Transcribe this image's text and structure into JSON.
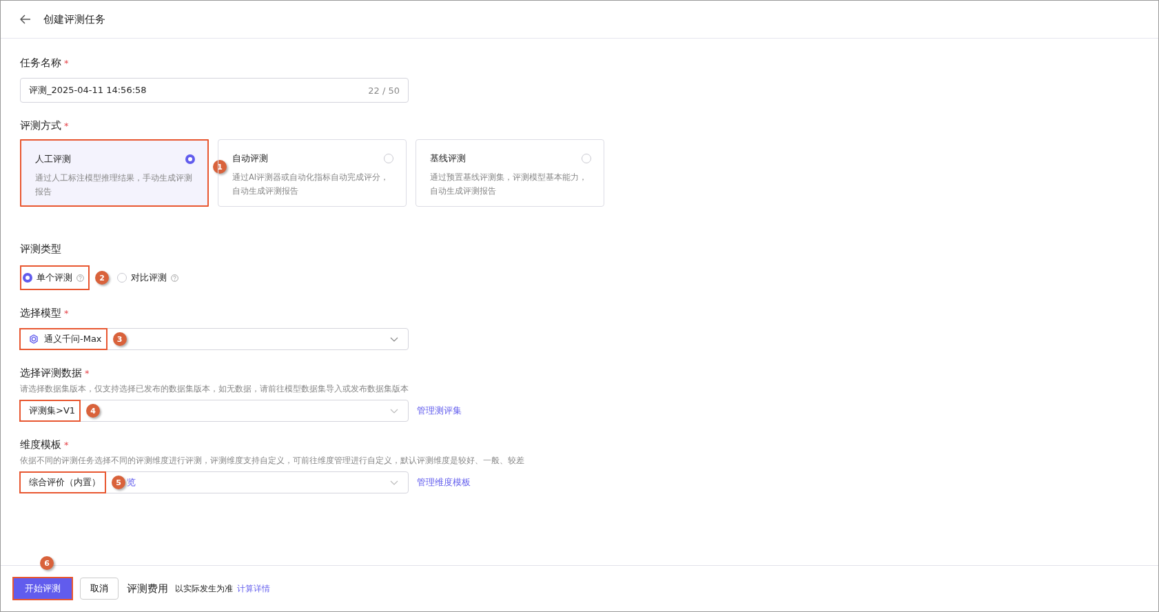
{
  "header": {
    "title": "创建评测任务"
  },
  "task_name": {
    "label": "任务名称",
    "required_mark": "*",
    "value": "评测_2025-04-11 14:56:58",
    "counter": "22 / 50"
  },
  "method": {
    "label": "评测方式",
    "required_mark": "*",
    "annotation": "1",
    "options": [
      {
        "title": "人工评测",
        "desc": "通过人工标注模型推理结果，手动生成评测报告",
        "selected": true
      },
      {
        "title": "自动评测",
        "desc": "通过AI评测器或自动化指标自动完成评分，自动生成评测报告",
        "selected": false
      },
      {
        "title": "基线评测",
        "desc": "通过预置基线评测集，评测模型基本能力，自动生成评测报告",
        "selected": false
      }
    ]
  },
  "eval_type": {
    "label": "评测类型",
    "annotation": "2",
    "options": [
      {
        "label": "单个评测",
        "selected": true
      },
      {
        "label": "对比评测",
        "selected": false
      }
    ]
  },
  "model": {
    "label": "选择模型",
    "required_mark": "*",
    "value": "通义千问-Max",
    "annotation": "3"
  },
  "dataset": {
    "label": "选择评测数据",
    "required_mark": "*",
    "hint": "请选择数据集版本，仅支持选择已发布的数据集版本，如无数据，请前往模型数据集导入或发布数据集版本",
    "value": "评测集>V1",
    "annotation": "4",
    "link": "管理测评集"
  },
  "template": {
    "label": "维度模板",
    "required_mark": "*",
    "hint": "依据不同的评测任务选择不同的评测维度进行评测，评测维度支持自定义，可前往维度管理进行自定义，默认评测维度是较好、一般、较差",
    "value": "综合评价（内置）",
    "annotation": "5",
    "preview": "览",
    "link": "管理维度模板"
  },
  "footer": {
    "start": "开始评测",
    "annotation": "6",
    "cancel": "取消",
    "fee_label": "评测费用",
    "fee_note": "以实际发生为准",
    "fee_link": "计算详情"
  }
}
